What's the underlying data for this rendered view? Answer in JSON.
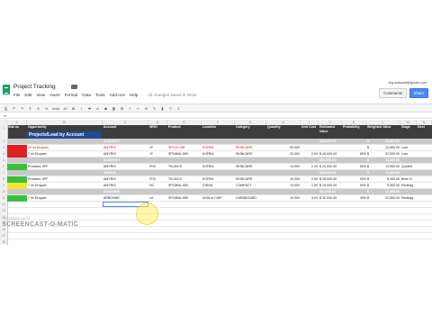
{
  "app": {
    "title": "Project Tracking",
    "user": "tkg.maksalf@gmail.com",
    "menu": [
      "File",
      "Edit",
      "View",
      "Insert",
      "Format",
      "Data",
      "Tools",
      "Add-ons",
      "Help"
    ],
    "saved_status": "All changes saved in Drive",
    "comments_label": "Comments",
    "share_label": "Share",
    "font": "Arial",
    "font_size": "10"
  },
  "columns": [
    "A",
    "B",
    "C",
    "D",
    "E",
    "F",
    "G",
    "H",
    "I",
    "J",
    "K",
    "L",
    "M",
    "N",
    "O",
    "P"
  ],
  "headers": [
    "Stat us",
    "Opportunity",
    "Account",
    "WHO",
    "Product",
    "Location",
    "Category",
    "Quantity",
    "Unit Cost",
    "Estimated Value",
    "Probability",
    "Weighted Value",
    "Stage",
    "Next"
  ],
  "banner": "Projects/Lead by Account",
  "rows": [
    {
      "type": "section",
      "account": "ALDEMIST",
      "est": "$46,000.00",
      "weighted": "$",
      "wvalue": "12,600.00"
    },
    {
      "status": "red",
      "opportunity": "25 ml Dropper",
      "account": "AMYRIS",
      "who": "JY",
      "product": "SP120-15B",
      "location": "KOREA",
      "category": "SKINCARE",
      "qty": "50,000",
      "unit": "",
      "est": "",
      "prob": "",
      "w": "$",
      "wv": "12,600.00",
      "stage": "Lost"
    },
    {
      "status": "red",
      "opportunity": "7 ml Dropper",
      "account": "AMYRIS",
      "who": "JY",
      "product": "SP18MA-15B",
      "location": "KOREA",
      "category": "SKINCARE",
      "qty": "20,000",
      "unit": "2.00",
      "est": "$ 40,000.00",
      "prob": "80%",
      "w": "$",
      "wv": "32,000.00",
      "stage": "Lost"
    },
    {
      "type": "section",
      "account": "ALDEMIST",
      "est": "$23,000.00",
      "weighted": "$",
      "wvalue": "11,500.00"
    },
    {
      "status": "green",
      "opportunity": "Protactor SPF",
      "account": "AMYRIS",
      "who": "FDV",
      "product": "TN-30CS",
      "location": "KOREA",
      "category": "SKINCARE",
      "qty": "10,000",
      "unit": "2.30",
      "est": "$ 23,000.00",
      "prob": "50%",
      "w": "$",
      "wv": "11,500.00",
      "stage": "Quoted"
    },
    {
      "type": "section",
      "account": "AMYRIS",
      "est": "$46,000.00",
      "weighted": "$",
      "wvalue": "12,600.00"
    },
    {
      "status": "green",
      "opportunity": "Protactor SPF",
      "account": "AMYRIS",
      "who": "FDV",
      "product": "TN-30CS",
      "location": "KOREA",
      "category": "SKINCARE",
      "qty": "10,000",
      "unit": "2.60",
      "est": "$ 26,000.00",
      "prob": "30%",
      "w": "$",
      "wv": "8,000.00",
      "stage": "Brief Cr"
    },
    {
      "status": "yellow",
      "opportunity": "7 ml Dropper",
      "account": "AMYRIS",
      "who": "HC",
      "product": "SP18MA-15B",
      "location": "CHINA",
      "category": "COMPACT",
      "qty": "10,000",
      "unit": "1.90",
      "est": "$ 19,000.00",
      "prob": "50%",
      "w": "$",
      "wv": "9,500.00",
      "stage": "Redesig"
    },
    {
      "type": "section",
      "account": "ARBONNE",
      "est": "$32,000.00",
      "weighted": "$",
      "wvalue": "12,800.00"
    },
    {
      "status": "green",
      "opportunity": "7 ml Dropper",
      "account": "ARBONNE",
      "who": "LA",
      "product": "SP18MA-15B",
      "location": "ASIA or CHIP",
      "category": "CARDBOARD",
      "qty": "10,000",
      "unit": "3.00",
      "est": "$ 32,000.00",
      "prob": "40%",
      "w": "$",
      "wv": "12,800.00",
      "stage": "Redesig"
    }
  ],
  "watermark": "SCREENCAST-O-MATIC",
  "recorded_label": "RECORDED WITH"
}
